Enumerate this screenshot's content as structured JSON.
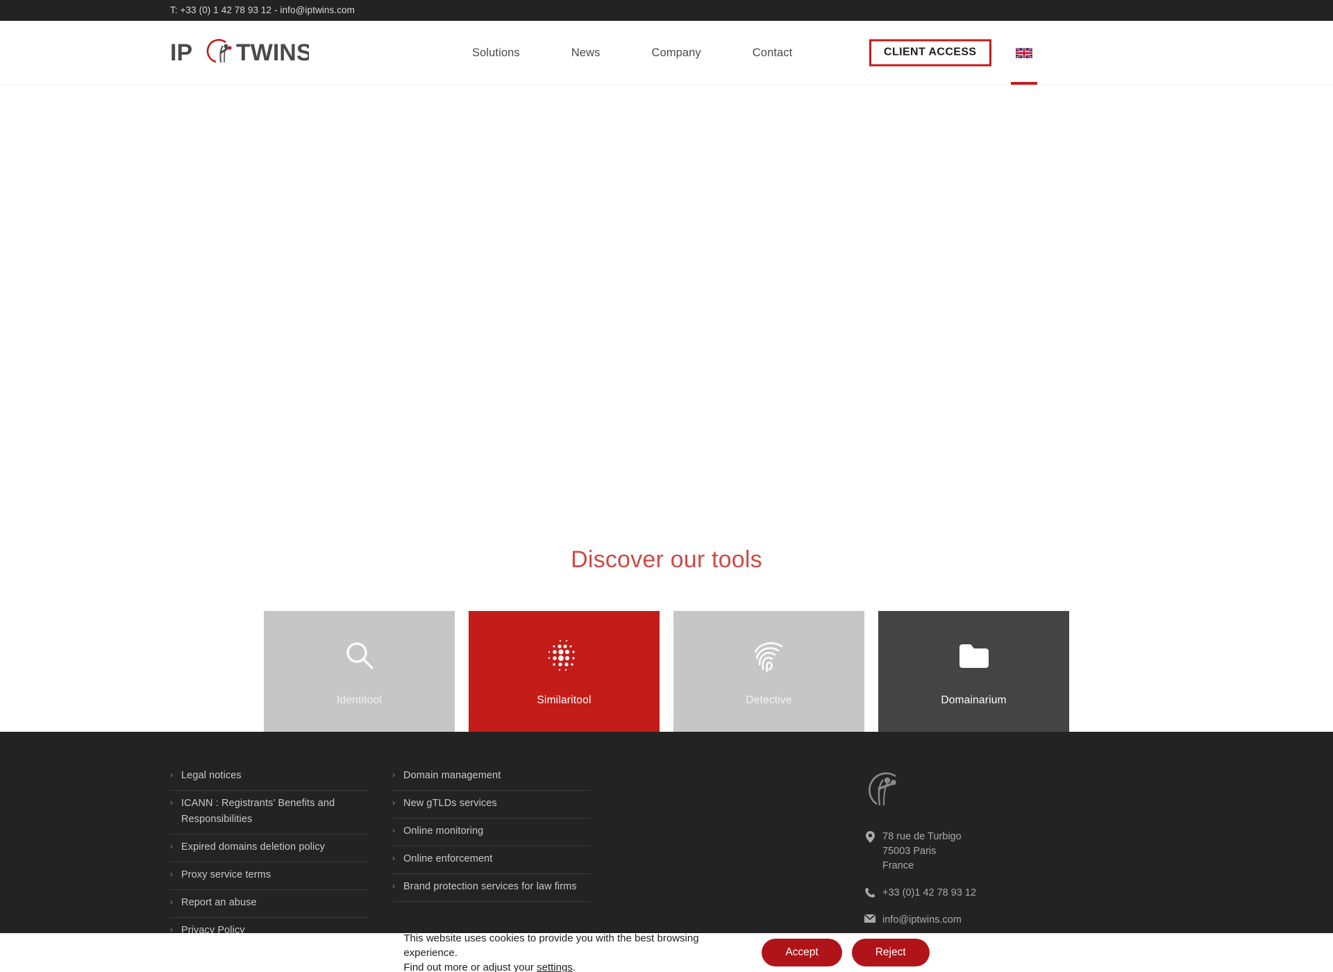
{
  "topbar": {
    "contact": "T: +33 (0) 1 42 78 93 12 - info@iptwins.com"
  },
  "header": {
    "logo_text_left": "IP",
    "logo_text_right": "TWINS",
    "logo_alt": "IP TWINS",
    "nav": [
      {
        "label": "Solutions"
      },
      {
        "label": "News"
      },
      {
        "label": "Company"
      },
      {
        "label": "Contact"
      }
    ],
    "client_access_label": "CLIENT ACCESS",
    "language": "English",
    "language_flag": "uk-flag-icon"
  },
  "tools": {
    "title": "Discover our tools",
    "cards": [
      {
        "label": "Identitool",
        "icon": "magnifier-icon",
        "style": "gray",
        "bg": "#c6c6c6"
      },
      {
        "label": "Similaritool",
        "icon": "halftone-dots-icon",
        "style": "red",
        "bg": "#c41c19"
      },
      {
        "label": "Detective",
        "icon": "fingerprint-icon",
        "style": "gray",
        "bg": "#c6c6c6"
      },
      {
        "label": "Domainarium",
        "icon": "folder-icon",
        "style": "dark",
        "bg": "#444444"
      }
    ]
  },
  "footer": {
    "column1": [
      "Legal notices",
      "ICANN : Registrants’ Benefits and Responsibilities",
      "Expired domains deletion policy",
      "Proxy service terms",
      "Report an abuse",
      "Privacy Policy"
    ],
    "column2": [
      "Domain management",
      "New gTLDs services",
      "Online monitoring",
      "Online enforcement",
      "Brand protection services for law firms"
    ],
    "contact": {
      "address_line1": "78 rue de Turbigo",
      "address_line2": "75003 Paris",
      "address_line3": "France",
      "phone": "+33 (0)1 42 78 93 12",
      "email": "info@iptwins.com"
    }
  },
  "cookie": {
    "line1": "This website uses cookies to provide you with the best browsing experience.",
    "line2_prefix": "Find out more or adjust your ",
    "line2_link": "settings",
    "line2_suffix": ".",
    "accept_label": "Accept",
    "reject_label": "Reject"
  },
  "colors": {
    "brand_red": "#c41c19",
    "dark": "#232323",
    "gray_card": "#c6c6c6",
    "dark_card": "#444444",
    "cookie_button": "#b01419"
  }
}
